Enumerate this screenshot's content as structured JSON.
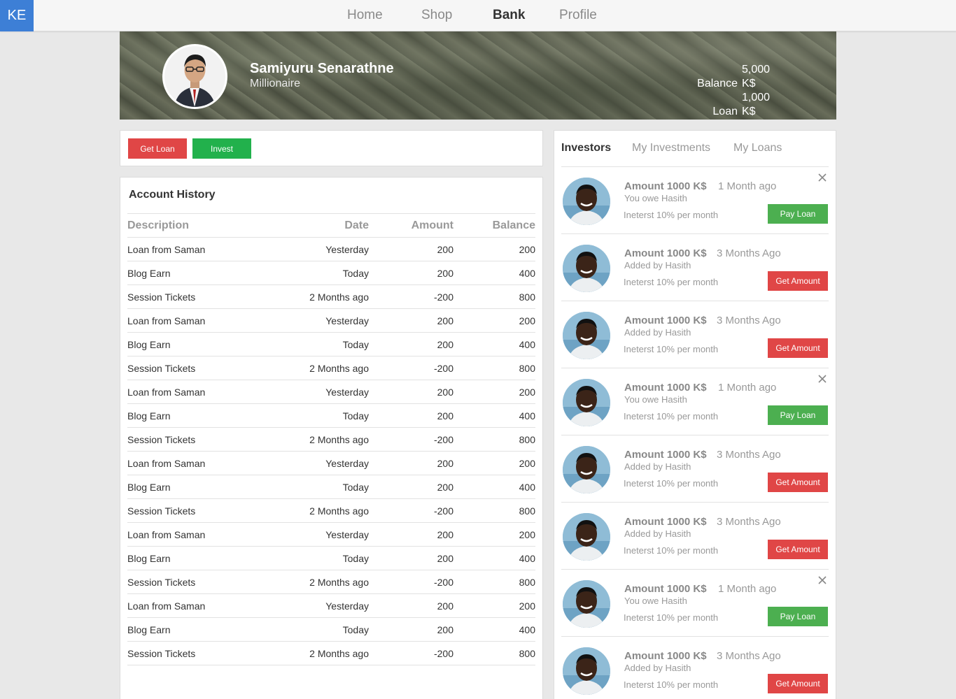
{
  "logo": "KE",
  "nav": [
    {
      "label": "Home",
      "active": false
    },
    {
      "label": "Shop",
      "active": false
    },
    {
      "label": "Bank",
      "active": true
    },
    {
      "label": "Profile",
      "active": false
    }
  ],
  "profile": {
    "name": "Samiyuru Senarathne",
    "title": "Millionaire",
    "balance_label": "Balance",
    "balance_value": "5,000 K$",
    "loan_label": "Loan",
    "loan_value": "1,000 K$"
  },
  "actions": {
    "get_loan": "Get Loan",
    "invest": "Invest"
  },
  "history": {
    "title": "Account History",
    "columns": [
      "Description",
      "Date",
      "Amount",
      "Balance"
    ],
    "rows": [
      [
        "Loan from Saman",
        "Yesterday",
        "200",
        "200"
      ],
      [
        "Blog Earn",
        "Today",
        "200",
        "400"
      ],
      [
        "Session Tickets",
        "2 Months ago",
        "-200",
        "800"
      ],
      [
        "Loan from Saman",
        "Yesterday",
        "200",
        "200"
      ],
      [
        "Blog Earn",
        "Today",
        "200",
        "400"
      ],
      [
        "Session Tickets",
        "2 Months ago",
        "-200",
        "800"
      ],
      [
        "Loan from Saman",
        "Yesterday",
        "200",
        "200"
      ],
      [
        "Blog Earn",
        "Today",
        "200",
        "400"
      ],
      [
        "Session Tickets",
        "2 Months ago",
        "-200",
        "800"
      ],
      [
        "Loan from Saman",
        "Yesterday",
        "200",
        "200"
      ],
      [
        "Blog Earn",
        "Today",
        "200",
        "400"
      ],
      [
        "Session Tickets",
        "2 Months ago",
        "-200",
        "800"
      ],
      [
        "Loan from Saman",
        "Yesterday",
        "200",
        "200"
      ],
      [
        "Blog Earn",
        "Today",
        "200",
        "400"
      ],
      [
        "Session Tickets",
        "2 Months ago",
        "-200",
        "800"
      ],
      [
        "Loan from Saman",
        "Yesterday",
        "200",
        "200"
      ],
      [
        "Blog Earn",
        "Today",
        "200",
        "400"
      ],
      [
        "Session Tickets",
        "2 Months ago",
        "-200",
        "800"
      ]
    ]
  },
  "investors": {
    "tabs": [
      {
        "label": "Investors",
        "active": true
      },
      {
        "label": "My Investments",
        "active": false
      },
      {
        "label": "My Loans",
        "active": false
      }
    ],
    "items": [
      {
        "amount": "Amount 1000 K$",
        "time": "1 Month ago",
        "sub": "You owe Hasith",
        "interest": "Ineterst 10% per month",
        "button": "Pay Loan",
        "kind": "pay",
        "closable": true
      },
      {
        "amount": "Amount 1000 K$",
        "time": "3 Months Ago",
        "sub": "Added by Hasith",
        "interest": "Ineterst 10% per month",
        "button": "Get Amount",
        "kind": "get",
        "closable": false
      },
      {
        "amount": "Amount 1000 K$",
        "time": "3 Months Ago",
        "sub": "Added by Hasith",
        "interest": "Ineterst 10% per month",
        "button": "Get Amount",
        "kind": "get",
        "closable": false
      },
      {
        "amount": "Amount 1000 K$",
        "time": "1 Month ago",
        "sub": "You owe Hasith",
        "interest": "Ineterst 10% per month",
        "button": "Pay Loan",
        "kind": "pay",
        "closable": true
      },
      {
        "amount": "Amount 1000 K$",
        "time": "3 Months Ago",
        "sub": "Added by Hasith",
        "interest": "Ineterst 10% per month",
        "button": "Get Amount",
        "kind": "get",
        "closable": false
      },
      {
        "amount": "Amount 1000 K$",
        "time": "3 Months Ago",
        "sub": "Added by Hasith",
        "interest": "Ineterst 10% per month",
        "button": "Get Amount",
        "kind": "get",
        "closable": false
      },
      {
        "amount": "Amount 1000 K$",
        "time": "1 Month ago",
        "sub": "You owe Hasith",
        "interest": "Ineterst 10% per month",
        "button": "Pay Loan",
        "kind": "pay",
        "closable": true
      },
      {
        "amount": "Amount 1000 K$",
        "time": "3 Months Ago",
        "sub": "Added by Hasith",
        "interest": "Ineterst 10% per month",
        "button": "Get Amount",
        "kind": "get",
        "closable": false
      }
    ]
  },
  "colors": {
    "accent_blue": "#3d7fd6",
    "red": "#e04646",
    "green": "#22b14c",
    "green_pay": "#4caf50"
  }
}
